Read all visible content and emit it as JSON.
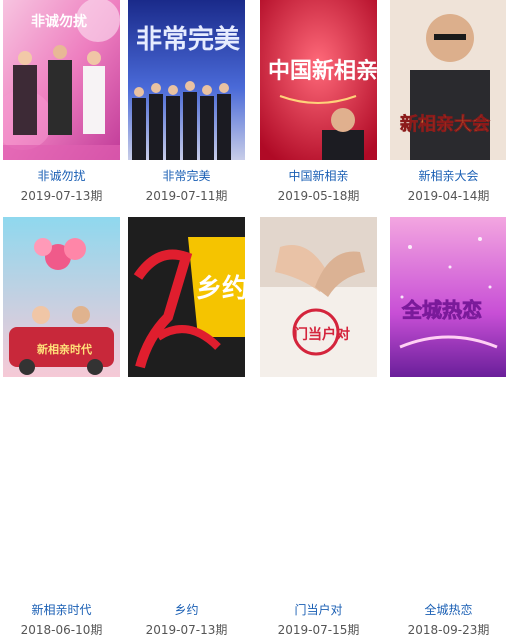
{
  "shows": [
    {
      "title": "非诚勿扰",
      "date": "2019-07-13期",
      "poster_text": "非诚勿扰",
      "accent": "#d94aa0"
    },
    {
      "title": "非常完美",
      "date": "2019-07-11期",
      "poster_text": "非常完美",
      "accent": "#3a4fb8"
    },
    {
      "title": "中国新相亲",
      "date": "2019-05-18期",
      "poster_text": "中国新相亲",
      "accent": "#c8102e"
    },
    {
      "title": "新相亲大会",
      "date": "2019-04-14期",
      "poster_text": "新相亲大会",
      "accent": "#8b1a1a"
    },
    {
      "title": "新相亲时代",
      "date": "2018-06-10期",
      "poster_text": "新相亲时代",
      "accent": "#e8487a"
    },
    {
      "title": "乡约",
      "date": "2019-07-13期",
      "poster_text": "乡约",
      "accent": "#e01e2e"
    },
    {
      "title": "门当户对",
      "date": "2019-07-15期",
      "poster_text": "门当户对",
      "accent": "#d4243c"
    },
    {
      "title": "全城热恋",
      "date": "2018-09-23期",
      "poster_text": "全城热恋",
      "accent": "#b43cc8"
    }
  ]
}
